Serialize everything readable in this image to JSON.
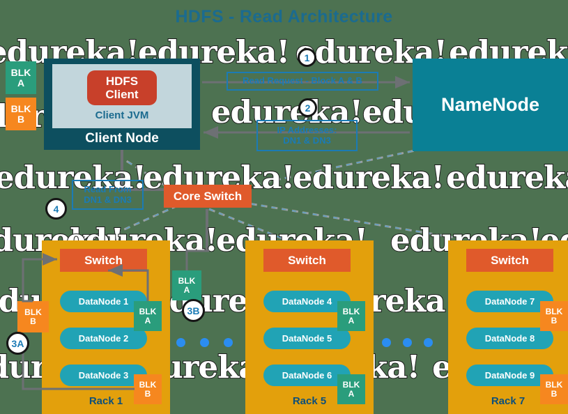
{
  "page": {
    "title": "HDFS - Read Architecture",
    "background_color": "#4d7251",
    "watermark_text": "edureka!"
  },
  "client": {
    "node_label": "Client Node",
    "jvm_label": "Client JVM",
    "hdfs_client_line1": "HDFS",
    "hdfs_client_line2": "Client",
    "blocks": [
      {
        "name": "BLK",
        "letter": "A",
        "type": "a"
      },
      {
        "name": "BLK",
        "letter": "B",
        "type": "b"
      }
    ]
  },
  "namenode": {
    "label": "NameNode"
  },
  "core_switch": {
    "label": "Core Switch"
  },
  "callouts": [
    {
      "id": "read-request",
      "line1": "Read Request - Block A & B",
      "line2": ""
    },
    {
      "id": "ip-addresses",
      "line1": "IP Addresses:",
      "line2": "DN1 & DN3"
    },
    {
      "id": "read-from",
      "line1": "Read From",
      "line2": "DN1 & DN3"
    }
  ],
  "badges": [
    {
      "id": "step-1",
      "label": "1"
    },
    {
      "id": "step-2",
      "label": "2"
    },
    {
      "id": "step-3a",
      "label": "3A"
    },
    {
      "id": "step-3b",
      "label": "3B"
    },
    {
      "id": "step-4",
      "label": "4"
    }
  ],
  "racks": [
    {
      "id": "rack-1",
      "label": "Rack 1",
      "switch_label": "Switch",
      "datanodes": [
        "DataNode 1",
        "DataNode 2",
        "DataNode 3"
      ],
      "blocks": [
        {
          "name": "BLK",
          "letter": "A",
          "type": "a",
          "attached_to": "DataNode 1"
        },
        {
          "name": "BLK",
          "letter": "B",
          "type": "b",
          "attached_to": "DataNode 3"
        },
        {
          "name": "BLK",
          "letter": "B",
          "type": "b",
          "attached_to": "outside-left"
        }
      ]
    },
    {
      "id": "rack-5",
      "label": "Rack 5",
      "switch_label": "Switch",
      "datanodes": [
        "DataNode 4",
        "DataNode 5",
        "DataNode 6"
      ],
      "blocks": [
        {
          "name": "BLK",
          "letter": "A",
          "type": "a",
          "attached_to": "DataNode 4"
        },
        {
          "name": "BLK",
          "letter": "A",
          "type": "a",
          "attached_to": "DataNode 6"
        },
        {
          "name": "BLK",
          "letter": "A",
          "type": "a",
          "attached_to": "outside-left"
        }
      ]
    },
    {
      "id": "rack-7",
      "label": "Rack 7",
      "switch_label": "Switch",
      "datanodes": [
        "DataNode 7",
        "DataNode 8",
        "DataNode 9"
      ],
      "blocks": [
        {
          "name": "BLK",
          "letter": "B",
          "type": "b",
          "attached_to": "DataNode 7"
        },
        {
          "name": "BLK",
          "letter": "B",
          "type": "b",
          "attached_to": "DataNode 9"
        }
      ]
    }
  ],
  "colors": {
    "title": "#1b6b8f",
    "namenode": "#0a8095",
    "client_node": "#0d4f5f",
    "client_jvm": "#c2d6dc",
    "hdfs_client": "#c8402a",
    "rack": "#e3a00c",
    "switch": "#e05a2b",
    "datanode": "#21a3b5",
    "block_a": "#2a9d7c",
    "block_b": "#f6871f",
    "callout_border": "#1b7bb5",
    "dot": "#2b8df0"
  }
}
